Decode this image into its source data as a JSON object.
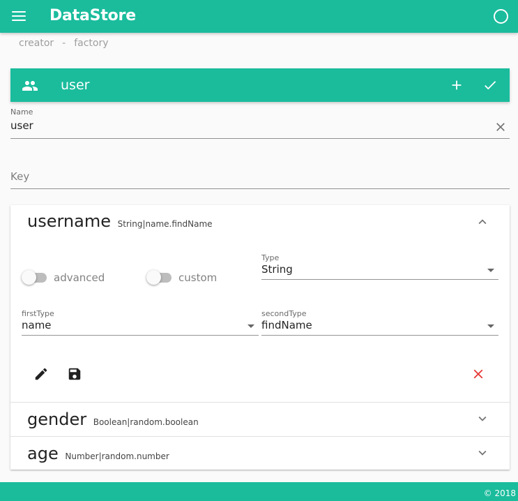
{
  "app": {
    "title": "DataStore"
  },
  "breadcrumb": {
    "items": [
      "creator",
      "factory"
    ],
    "separator": "-"
  },
  "section": {
    "title": "user"
  },
  "name_field": {
    "label": "Name",
    "value": "user"
  },
  "key_field": {
    "placeholder": "Key"
  },
  "fields": [
    {
      "name": "username",
      "type_desc": "String|name.findName",
      "expanded": true,
      "advanced_label": "advanced",
      "custom_label": "custom",
      "type": {
        "label": "Type",
        "value": "String"
      },
      "first_type": {
        "label": "firstType",
        "value": "name"
      },
      "second_type": {
        "label": "secondType",
        "value": "findName"
      }
    },
    {
      "name": "gender",
      "type_desc": "Boolean|random.boolean",
      "expanded": false
    },
    {
      "name": "age",
      "type_desc": "Number|random.number",
      "expanded": false
    }
  ],
  "footer": {
    "text": "© 2018"
  },
  "colors": {
    "primary": "#1abc9c",
    "danger": "#e53935"
  },
  "icons": {
    "menu": "menu-icon",
    "account": "circle-icon",
    "people": "people-icon",
    "add": "add-icon",
    "check": "check-icon",
    "clear": "close-icon",
    "edit": "pencil-icon",
    "save": "floppy-disk-icon",
    "delete": "close-icon"
  }
}
